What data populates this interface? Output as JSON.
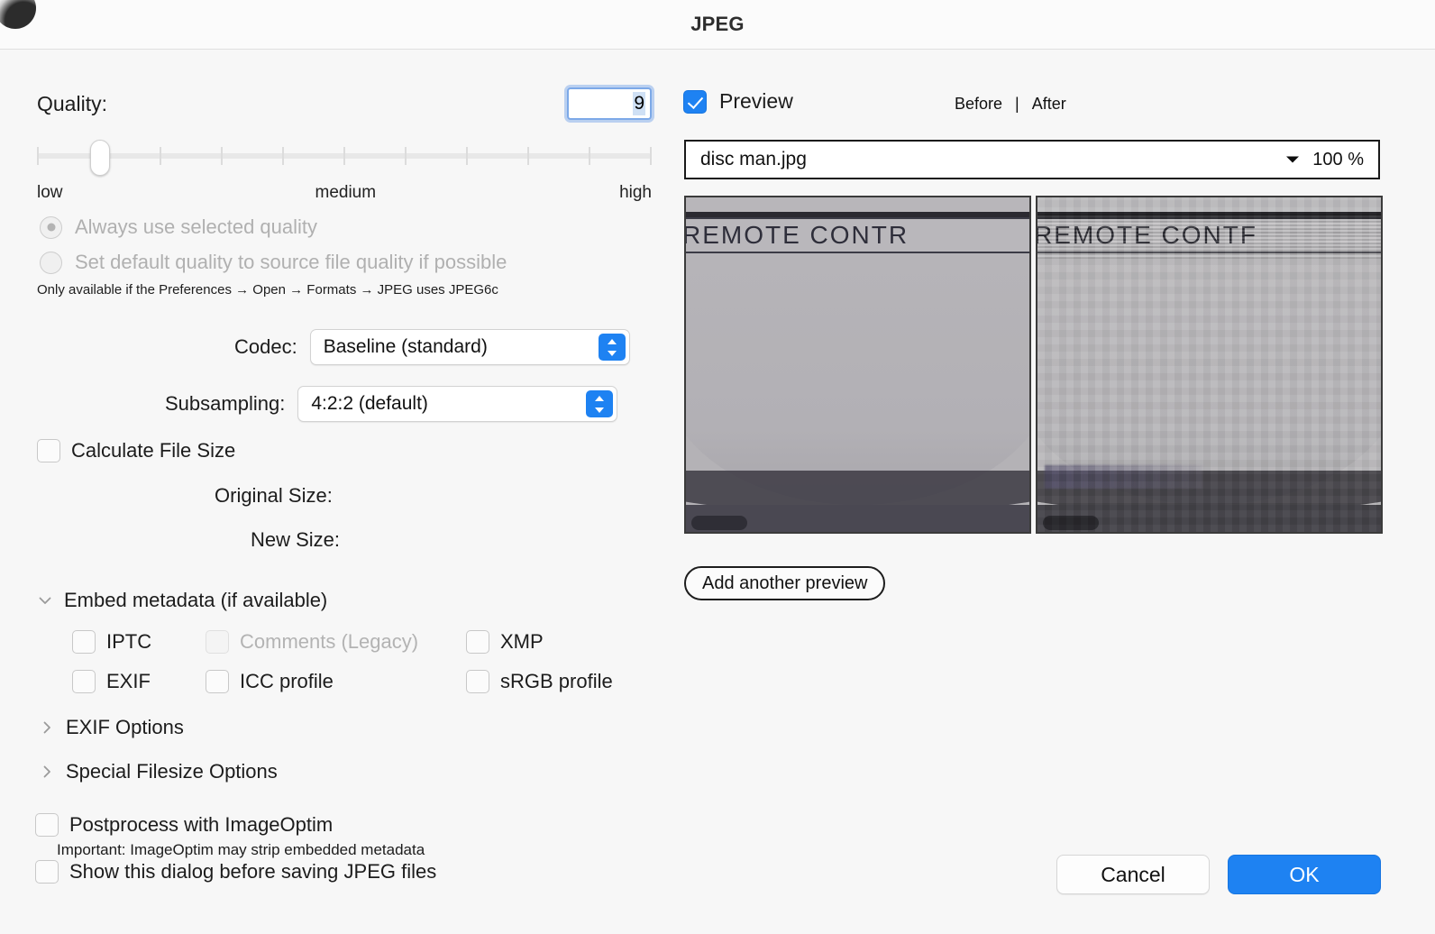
{
  "window": {
    "title": "JPEG"
  },
  "quality": {
    "label": "Quality:",
    "value": "9",
    "legend_low": "low",
    "legend_medium": "medium",
    "legend_high": "high",
    "slider_percent": 9,
    "tick_count": 11
  },
  "quality_mode": {
    "option_always": "Always use selected quality",
    "option_source": "Set default quality to source file quality if possible",
    "selected": "always",
    "disabled": true,
    "note": "Only available if the Preferences → Open → Formats → JPEG uses JPEG6c"
  },
  "codec": {
    "label": "Codec:",
    "value": "Baseline (standard)"
  },
  "subsampling": {
    "label": "Subsampling:",
    "value": "4:2:2 (default)"
  },
  "filesize": {
    "calculate_label": "Calculate File Size",
    "calculate_checked": false,
    "original_label": "Original Size:",
    "original_value": "",
    "new_label": "New Size:",
    "new_value": ""
  },
  "metadata": {
    "group_label": "Embed metadata (if available)",
    "expanded": true,
    "items": [
      {
        "label": "IPTC",
        "checked": false,
        "disabled": false
      },
      {
        "label": "Comments (Legacy)",
        "checked": false,
        "disabled": true
      },
      {
        "label": "XMP",
        "checked": false,
        "disabled": false
      },
      {
        "label": "EXIF",
        "checked": false,
        "disabled": false
      },
      {
        "label": "ICC profile",
        "checked": false,
        "disabled": false
      },
      {
        "label": "sRGB profile",
        "checked": false,
        "disabled": false
      }
    ]
  },
  "sections": {
    "exif_options": "EXIF Options",
    "special_filesize_options": "Special Filesize Options"
  },
  "postprocess": {
    "label": "Postprocess with ImageOptim",
    "checked": false,
    "note": "Important: ImageOptim may strip embedded metadata"
  },
  "show_dialog": {
    "label": "Show this dialog before saving JPEG files",
    "checked": false
  },
  "preview": {
    "checkbox_label": "Preview",
    "checked": true,
    "before_label": "Before",
    "separator": "|",
    "after_label": "After",
    "file_name": "disc man.jpg",
    "zoom_level": "100 %",
    "photo_text": "REMOTE CONTR",
    "photo_text_after": "REMOTE CONTF",
    "add_preview_label": "Add another preview"
  },
  "actions": {
    "cancel_label": "Cancel",
    "ok_label": "OK"
  },
  "colors": {
    "accent": "#1e82f2",
    "window_bg": "#f7f7f7",
    "titlebar_bg": "#fbfbfb",
    "disabled_text": "#b0b0b0"
  }
}
